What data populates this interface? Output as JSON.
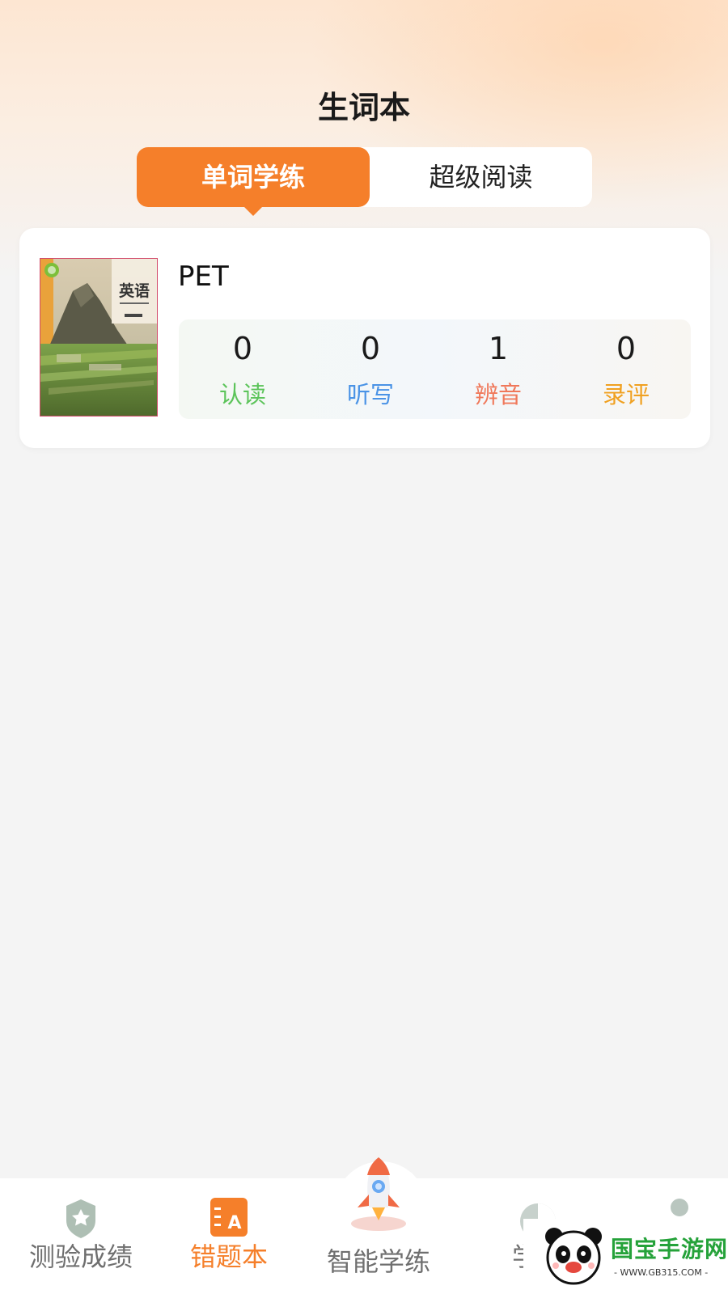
{
  "page": {
    "title": "生词本"
  },
  "tabs": [
    {
      "label": "单词学练",
      "active": true
    },
    {
      "label": "超级阅读",
      "active": false
    }
  ],
  "book": {
    "name": "PET",
    "cover_title": "英语",
    "stats": [
      {
        "value": "0",
        "label": "认读",
        "color": "#5cc45a"
      },
      {
        "value": "0",
        "label": "听写",
        "color": "#4a93e6"
      },
      {
        "value": "1",
        "label": "辨音",
        "color": "#f0785a"
      },
      {
        "value": "0",
        "label": "录评",
        "color": "#f0a020"
      }
    ]
  },
  "bottom_nav": [
    {
      "label": "测验成绩",
      "icon": "medal-icon",
      "active": false
    },
    {
      "label": "错题本",
      "icon": "notebook-icon",
      "active": true
    },
    {
      "label": "智能学练",
      "icon": "rocket-icon",
      "active": false
    },
    {
      "label": "学习",
      "icon": "chart-icon",
      "active": false
    },
    {
      "label": "",
      "icon": "user-icon",
      "active": false
    }
  ],
  "watermark": {
    "text": "国宝手游网",
    "sub": "- WWW.GB315.COM -"
  },
  "colors": {
    "accent": "#f57f2a"
  }
}
